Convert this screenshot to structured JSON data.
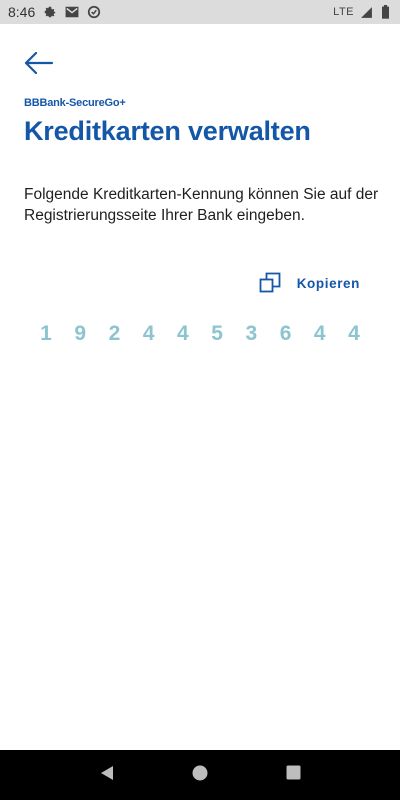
{
  "status_bar": {
    "time": "8:46",
    "network": "LTE",
    "icons": [
      "gear-icon",
      "gmail-icon",
      "data-saver-icon",
      "signal-icon",
      "battery-icon"
    ]
  },
  "header": {
    "back_icon": "arrow-left-icon",
    "app_name": "BBBank-SecureGo+",
    "title": "Kreditkarten verwalten"
  },
  "main": {
    "description": "Folgende Kreditkarten-Kennung können Sie auf der Registrierungsseite Ihrer Bank eingeben.",
    "copy_label": "Kopieren",
    "card_id_digits": [
      "1",
      "9",
      "2",
      "4",
      "4",
      "5",
      "3",
      "6",
      "4",
      "4"
    ]
  },
  "nav_bar": {
    "buttons": [
      "back-triangle-icon",
      "home-circle-icon",
      "recents-square-icon"
    ]
  },
  "colors": {
    "accent": "#1457a8",
    "digits": "#8cc4cf",
    "status_bar_bg": "#dcdcdc",
    "nav_bar_bg": "#000000"
  }
}
